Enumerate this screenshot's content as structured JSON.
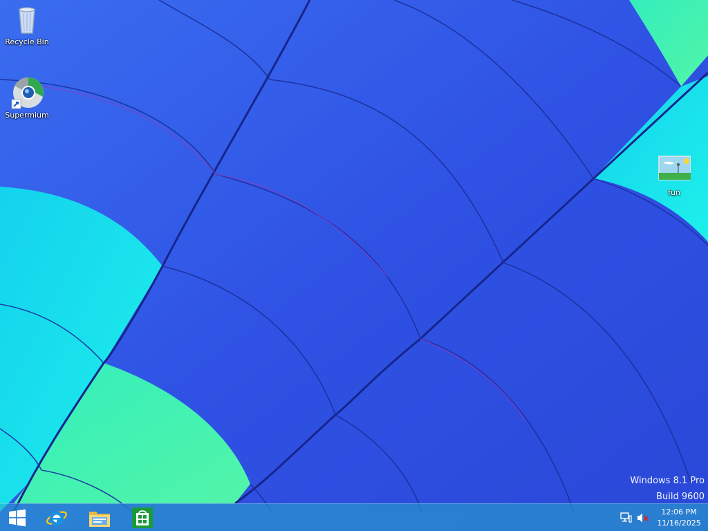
{
  "desktop": {
    "icons": [
      {
        "label": "Recycle Bin",
        "icon": "recycle-bin-icon"
      },
      {
        "label": "Supermium",
        "icon": "supermium-browser-icon"
      },
      {
        "label": "fun",
        "icon": "image-file-icon"
      }
    ]
  },
  "watermark": {
    "line1": "Windows 8.1 Pro",
    "line2": "Build 9600"
  },
  "taskbar": {
    "pinned": [
      {
        "icon": "windows-start-icon"
      },
      {
        "icon": "internet-explorer-icon"
      },
      {
        "icon": "file-explorer-icon"
      },
      {
        "icon": "windows-store-icon"
      }
    ],
    "tray": {
      "network_icon": "network-icon",
      "volume_icon": "volume-muted-icon",
      "time": "12:06 PM",
      "date": "11/16/2025"
    }
  },
  "colors": {
    "wallpaper_blue": "#2f55e6",
    "wallpaper_cyan": "#18e6ee",
    "wallpaper_green": "#3ff2b0",
    "seam": "#1a2a9a",
    "taskbar_tint": "#28aac8",
    "text": "#ffffff"
  }
}
